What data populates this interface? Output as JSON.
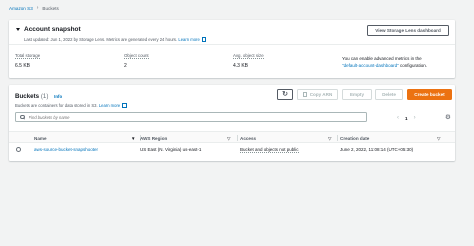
{
  "breadcrumb": {
    "service": "Amazon S3",
    "current": "Buckets"
  },
  "snapshot": {
    "title": "Account snapshot",
    "subtitle": "Last updated: Jun 1, 2022 by Storage Lens. Metrics are generated every 24 hours.",
    "learn_more": "Learn more",
    "view_dashboard_label": "View Storage Lens dashboard",
    "metrics": [
      {
        "label": "Total storage",
        "value": "6.5 KB"
      },
      {
        "label": "Object count",
        "value": "2"
      },
      {
        "label": "Avg. object size",
        "value": "4.3 KB"
      }
    ],
    "note_prefix": "You can enable advanced metrics in the",
    "note_link": "\"default-account-dashboard\"",
    "note_suffix": "configuration."
  },
  "buckets": {
    "title": "Buckets",
    "count": "(1)",
    "info": "Info",
    "subtitle": "Buckets are containers for data stored in S3.",
    "learn_more": "Learn more",
    "buttons": {
      "copy_arn": "Copy ARN",
      "empty": "Empty",
      "delete": "Delete",
      "create": "Create bucket"
    },
    "search_placeholder": "Find buckets by name",
    "pager": {
      "prev": "‹",
      "page": "1",
      "next": "›"
    },
    "columns": [
      "Name",
      "AWS Region",
      "Access",
      "Creation date"
    ],
    "rows": [
      {
        "name": "aws-source-bucket-snapshooter",
        "region": "US East (N. Virginia) us-east-1",
        "access": "Bucket and objects not public",
        "created": "June 2, 2022, 11:08:14 (UTC+05:30)"
      }
    ]
  },
  "colors": {
    "link": "#0073bb",
    "primary": "#ec7211",
    "background": "#f2f3f3"
  },
  "icons": [
    "chevron-right-icon",
    "caret-down-icon",
    "external-link-icon",
    "refresh-icon",
    "search-icon",
    "settings-icon",
    "sort-icon"
  ]
}
